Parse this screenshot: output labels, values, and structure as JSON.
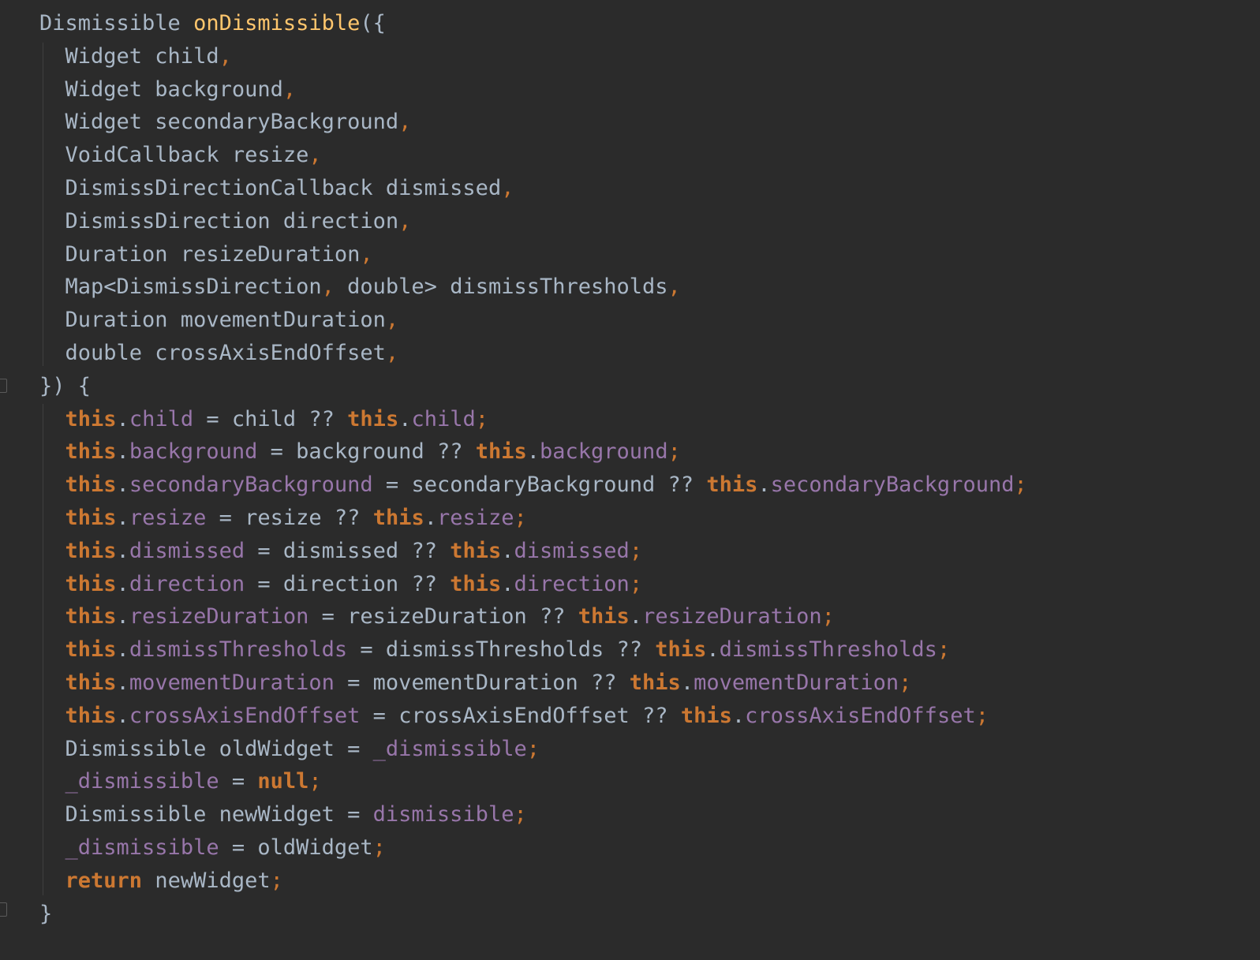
{
  "editor": {
    "colors": {
      "background": "#2b2b2b",
      "plain": "#a9b7c6",
      "function": "#ffc66d",
      "keyword": "#cc7832",
      "field": "#9876aa",
      "punctuation": "#cc7832"
    },
    "gutter_icons": [
      "fold-marker-icon",
      "fold-marker-icon"
    ],
    "lines": [
      [
        {
          "t": "Dismissible ",
          "c": "plain"
        },
        {
          "t": "onDismissible",
          "c": "fn"
        },
        {
          "t": "({",
          "c": "plain"
        }
      ],
      [
        {
          "t": "  Widget child",
          "c": "plain"
        },
        {
          "t": ",",
          "c": "punct"
        }
      ],
      [
        {
          "t": "  Widget background",
          "c": "plain"
        },
        {
          "t": ",",
          "c": "punct"
        }
      ],
      [
        {
          "t": "  Widget secondaryBackground",
          "c": "plain"
        },
        {
          "t": ",",
          "c": "punct"
        }
      ],
      [
        {
          "t": "  VoidCallback resize",
          "c": "plain"
        },
        {
          "t": ",",
          "c": "punct"
        }
      ],
      [
        {
          "t": "  DismissDirectionCallback dismissed",
          "c": "plain"
        },
        {
          "t": ",",
          "c": "punct"
        }
      ],
      [
        {
          "t": "  DismissDirection direction",
          "c": "plain"
        },
        {
          "t": ",",
          "c": "punct"
        }
      ],
      [
        {
          "t": "  Duration resizeDuration",
          "c": "plain"
        },
        {
          "t": ",",
          "c": "punct"
        }
      ],
      [
        {
          "t": "  Map<DismissDirection",
          "c": "plain"
        },
        {
          "t": ",",
          "c": "punct"
        },
        {
          "t": " double> dismissThresholds",
          "c": "plain"
        },
        {
          "t": ",",
          "c": "punct"
        }
      ],
      [
        {
          "t": "  Duration movementDuration",
          "c": "plain"
        },
        {
          "t": ",",
          "c": "punct"
        }
      ],
      [
        {
          "t": "  double crossAxisEndOffset",
          "c": "plain"
        },
        {
          "t": ",",
          "c": "punct"
        }
      ],
      [
        {
          "t": "}) {",
          "c": "plain"
        }
      ],
      [
        {
          "t": "  ",
          "c": "plain"
        },
        {
          "t": "this",
          "c": "kw"
        },
        {
          "t": ".",
          "c": "plain"
        },
        {
          "t": "child",
          "c": "field"
        },
        {
          "t": " = child ?? ",
          "c": "plain"
        },
        {
          "t": "this",
          "c": "kw"
        },
        {
          "t": ".",
          "c": "plain"
        },
        {
          "t": "child",
          "c": "field"
        },
        {
          "t": ";",
          "c": "punct"
        }
      ],
      [
        {
          "t": "  ",
          "c": "plain"
        },
        {
          "t": "this",
          "c": "kw"
        },
        {
          "t": ".",
          "c": "plain"
        },
        {
          "t": "background",
          "c": "field"
        },
        {
          "t": " = background ?? ",
          "c": "plain"
        },
        {
          "t": "this",
          "c": "kw"
        },
        {
          "t": ".",
          "c": "plain"
        },
        {
          "t": "background",
          "c": "field"
        },
        {
          "t": ";",
          "c": "punct"
        }
      ],
      [
        {
          "t": "  ",
          "c": "plain"
        },
        {
          "t": "this",
          "c": "kw"
        },
        {
          "t": ".",
          "c": "plain"
        },
        {
          "t": "secondaryBackground",
          "c": "field"
        },
        {
          "t": " = secondaryBackground ?? ",
          "c": "plain"
        },
        {
          "t": "this",
          "c": "kw"
        },
        {
          "t": ".",
          "c": "plain"
        },
        {
          "t": "secondaryBackground",
          "c": "field"
        },
        {
          "t": ";",
          "c": "punct"
        }
      ],
      [
        {
          "t": "  ",
          "c": "plain"
        },
        {
          "t": "this",
          "c": "kw"
        },
        {
          "t": ".",
          "c": "plain"
        },
        {
          "t": "resize",
          "c": "field"
        },
        {
          "t": " = resize ?? ",
          "c": "plain"
        },
        {
          "t": "this",
          "c": "kw"
        },
        {
          "t": ".",
          "c": "plain"
        },
        {
          "t": "resize",
          "c": "field"
        },
        {
          "t": ";",
          "c": "punct"
        }
      ],
      [
        {
          "t": "  ",
          "c": "plain"
        },
        {
          "t": "this",
          "c": "kw"
        },
        {
          "t": ".",
          "c": "plain"
        },
        {
          "t": "dismissed",
          "c": "field"
        },
        {
          "t": " = dismissed ?? ",
          "c": "plain"
        },
        {
          "t": "this",
          "c": "kw"
        },
        {
          "t": ".",
          "c": "plain"
        },
        {
          "t": "dismissed",
          "c": "field"
        },
        {
          "t": ";",
          "c": "punct"
        }
      ],
      [
        {
          "t": "  ",
          "c": "plain"
        },
        {
          "t": "this",
          "c": "kw"
        },
        {
          "t": ".",
          "c": "plain"
        },
        {
          "t": "direction",
          "c": "field"
        },
        {
          "t": " = direction ?? ",
          "c": "plain"
        },
        {
          "t": "this",
          "c": "kw"
        },
        {
          "t": ".",
          "c": "plain"
        },
        {
          "t": "direction",
          "c": "field"
        },
        {
          "t": ";",
          "c": "punct"
        }
      ],
      [
        {
          "t": "  ",
          "c": "plain"
        },
        {
          "t": "this",
          "c": "kw"
        },
        {
          "t": ".",
          "c": "plain"
        },
        {
          "t": "resizeDuration",
          "c": "field"
        },
        {
          "t": " = resizeDuration ?? ",
          "c": "plain"
        },
        {
          "t": "this",
          "c": "kw"
        },
        {
          "t": ".",
          "c": "plain"
        },
        {
          "t": "resizeDuration",
          "c": "field"
        },
        {
          "t": ";",
          "c": "punct"
        }
      ],
      [
        {
          "t": "  ",
          "c": "plain"
        },
        {
          "t": "this",
          "c": "kw"
        },
        {
          "t": ".",
          "c": "plain"
        },
        {
          "t": "dismissThresholds",
          "c": "field"
        },
        {
          "t": " = dismissThresholds ?? ",
          "c": "plain"
        },
        {
          "t": "this",
          "c": "kw"
        },
        {
          "t": ".",
          "c": "plain"
        },
        {
          "t": "dismissThresholds",
          "c": "field"
        },
        {
          "t": ";",
          "c": "punct"
        }
      ],
      [
        {
          "t": "  ",
          "c": "plain"
        },
        {
          "t": "this",
          "c": "kw"
        },
        {
          "t": ".",
          "c": "plain"
        },
        {
          "t": "movementDuration",
          "c": "field"
        },
        {
          "t": " = movementDuration ?? ",
          "c": "plain"
        },
        {
          "t": "this",
          "c": "kw"
        },
        {
          "t": ".",
          "c": "plain"
        },
        {
          "t": "movementDuration",
          "c": "field"
        },
        {
          "t": ";",
          "c": "punct"
        }
      ],
      [
        {
          "t": "  ",
          "c": "plain"
        },
        {
          "t": "this",
          "c": "kw"
        },
        {
          "t": ".",
          "c": "plain"
        },
        {
          "t": "crossAxisEndOffset",
          "c": "field"
        },
        {
          "t": " = crossAxisEndOffset ?? ",
          "c": "plain"
        },
        {
          "t": "this",
          "c": "kw"
        },
        {
          "t": ".",
          "c": "plain"
        },
        {
          "t": "crossAxisEndOffset",
          "c": "field"
        },
        {
          "t": ";",
          "c": "punct"
        }
      ],
      [
        {
          "t": "  Dismissible oldWidget = ",
          "c": "plain"
        },
        {
          "t": "_dismissible",
          "c": "field"
        },
        {
          "t": ";",
          "c": "punct"
        }
      ],
      [
        {
          "t": "  ",
          "c": "plain"
        },
        {
          "t": "_dismissible",
          "c": "field"
        },
        {
          "t": " = ",
          "c": "plain"
        },
        {
          "t": "null",
          "c": "kw"
        },
        {
          "t": ";",
          "c": "punct"
        }
      ],
      [
        {
          "t": "  Dismissible newWidget = ",
          "c": "plain"
        },
        {
          "t": "dismissible",
          "c": "field"
        },
        {
          "t": ";",
          "c": "punct"
        }
      ],
      [
        {
          "t": "  ",
          "c": "plain"
        },
        {
          "t": "_dismissible",
          "c": "field"
        },
        {
          "t": " = oldWidget",
          "c": "plain"
        },
        {
          "t": ";",
          "c": "punct"
        }
      ],
      [
        {
          "t": "  ",
          "c": "plain"
        },
        {
          "t": "return",
          "c": "kw"
        },
        {
          "t": " newWidget",
          "c": "plain"
        },
        {
          "t": ";",
          "c": "punct"
        }
      ],
      [
        {
          "t": "}",
          "c": "plain"
        }
      ]
    ]
  }
}
